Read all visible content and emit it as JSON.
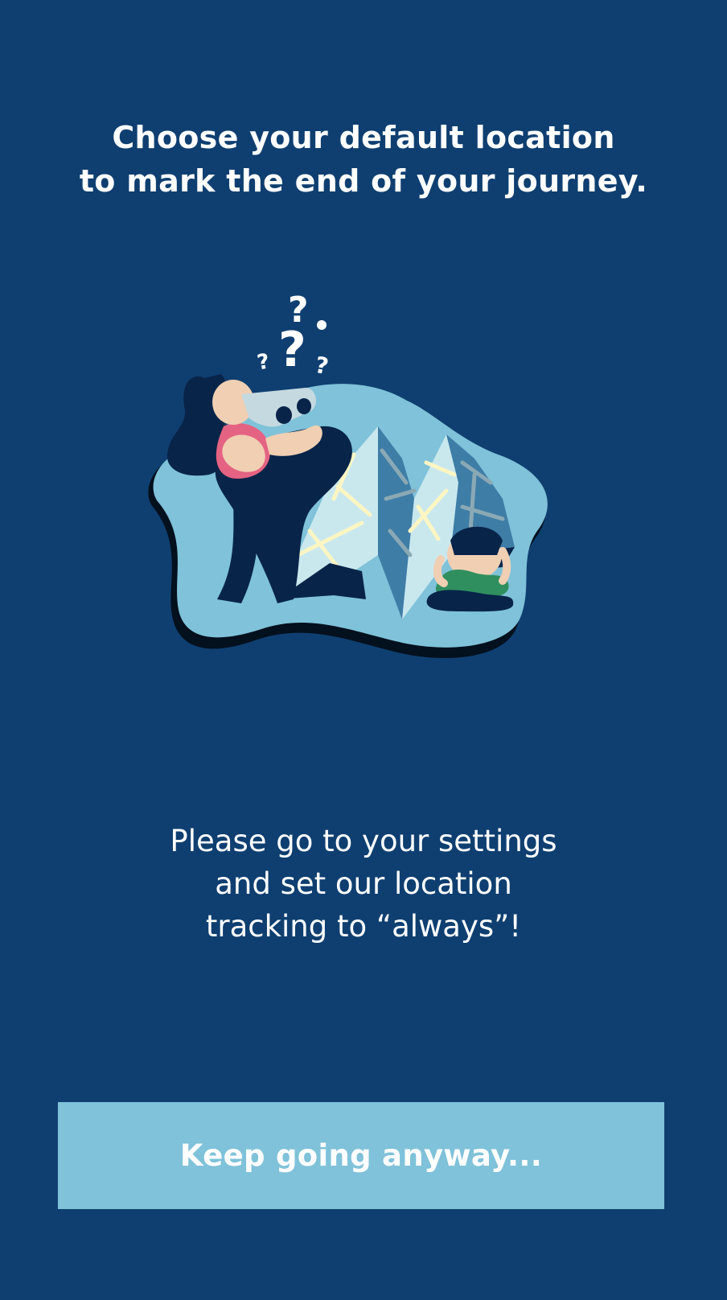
{
  "header": {
    "title_line1": "Choose your default location",
    "title_line2": "to mark the end of your journey."
  },
  "illustration": {
    "icon": "lost-traveler-with-map-illustration",
    "colors": {
      "blob": "#7fc2d9",
      "map_light": "#c9e8ee",
      "map_dark": "#3e7da6",
      "roads": "#fdf6c3",
      "figure": "#082449",
      "skin": "#f0cfb3",
      "shirt_pink": "#e56382",
      "shirt_green": "#2f8f5f"
    }
  },
  "message": {
    "line1": "Please go to your settings",
    "line2": "and set our location",
    "line3": "tracking to “always”!"
  },
  "actions": {
    "keep_going_label": "Keep going anyway..."
  },
  "colors": {
    "background": "#0f3f70",
    "button": "#7fc2d9",
    "text": "#ffffff"
  }
}
